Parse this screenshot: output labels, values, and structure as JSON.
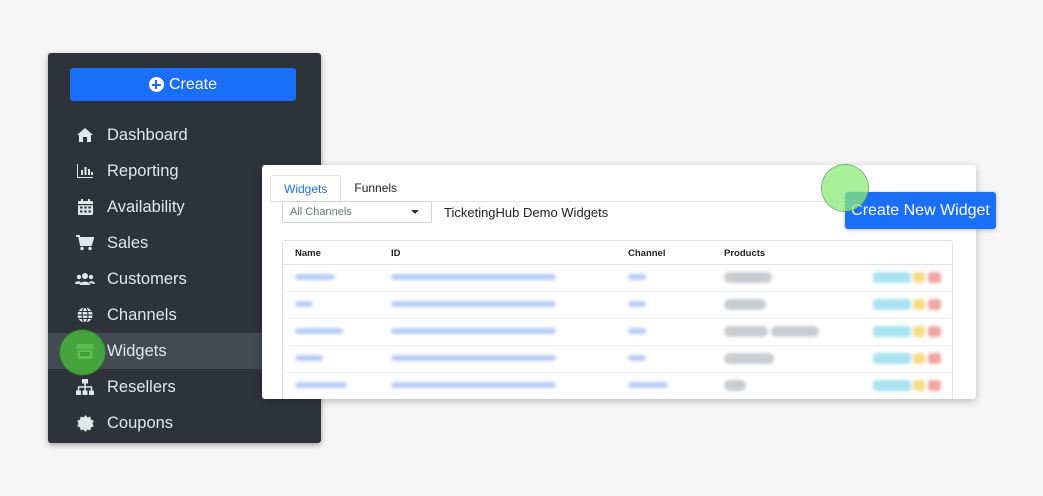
{
  "sidebar": {
    "create_label": "Create",
    "items": [
      {
        "label": "Dashboard",
        "icon": "home-icon"
      },
      {
        "label": "Reporting",
        "icon": "bar-chart-icon"
      },
      {
        "label": "Availability",
        "icon": "calendar-icon"
      },
      {
        "label": "Sales",
        "icon": "shopping-cart-icon"
      },
      {
        "label": "Customers",
        "icon": "users-icon"
      },
      {
        "label": "Channels",
        "icon": "globe-icon"
      },
      {
        "label": "Widgets",
        "icon": "store-icon",
        "active": true
      },
      {
        "label": "Resellers",
        "icon": "sitemap-icon"
      },
      {
        "label": "Coupons",
        "icon": "certificate-icon"
      }
    ]
  },
  "widgets_panel": {
    "tabs": [
      {
        "label": "Widgets",
        "active": true
      },
      {
        "label": "Funnels"
      }
    ],
    "channel_filter": "All Channels",
    "title": "TicketingHub Demo Widgets",
    "create_button": "Create New Widget",
    "table": {
      "columns": [
        "Name",
        "ID",
        "Channel",
        "Products"
      ],
      "rows": 5
    }
  },
  "colors": {
    "sidebar_bg": "#2d3339",
    "accent": "#1a6ef7",
    "active_item_bg": "#434a52",
    "click_highlight": "#46b43c"
  }
}
